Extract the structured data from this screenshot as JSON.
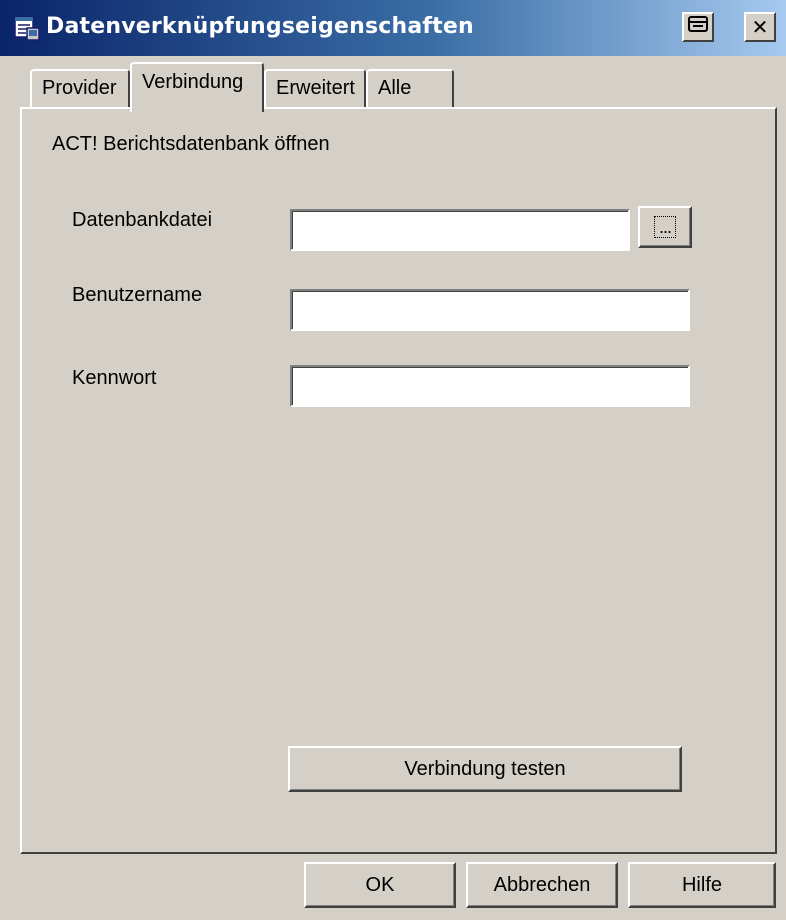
{
  "window": {
    "title": "Datenverknüpfungseigenschaften",
    "close_glyph": "✕",
    "title_bar_colors": [
      "#0a246a",
      "#3a6ea5"
    ],
    "icons": {
      "app": "data-link-icon",
      "help": "help-icon",
      "close": "close-icon"
    }
  },
  "tabs": [
    {
      "label": "Provider",
      "active": false
    },
    {
      "label": "Verbindung",
      "active": true
    },
    {
      "label": "Erweitert",
      "active": false
    },
    {
      "label": "Alle",
      "active": false
    }
  ],
  "panel": {
    "heading": "ACT! Berichtsdatenbank öffnen",
    "fields": {
      "database": {
        "label": "Datenbankdatei",
        "value": ""
      },
      "username": {
        "label": "Benutzername",
        "value": ""
      },
      "password": {
        "label": "Kennwort",
        "value": ""
      }
    },
    "browse_label": "...",
    "test_button": "Verbindung testen"
  },
  "buttons": {
    "ok": "OK",
    "cancel": "Abbrechen",
    "help": "Hilfe"
  }
}
